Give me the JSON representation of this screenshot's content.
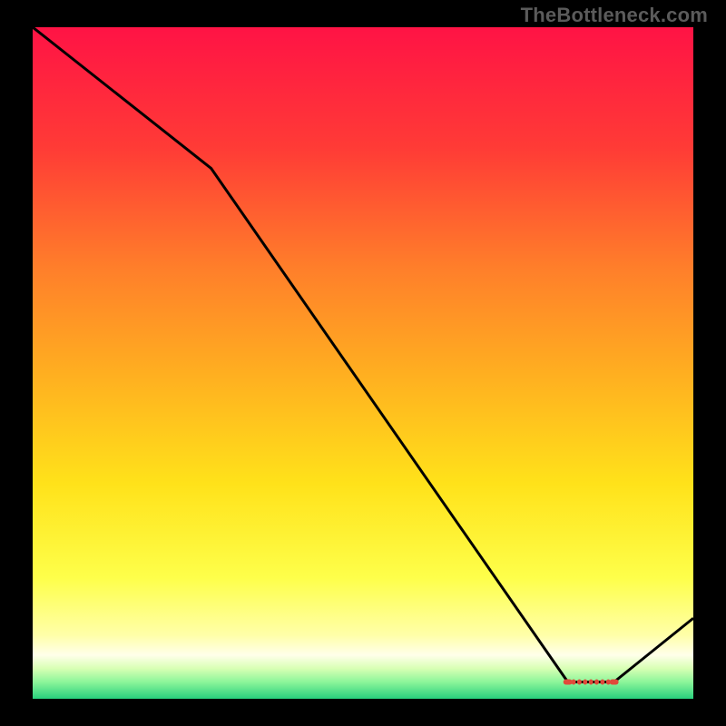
{
  "watermark": "TheBottleneck.com",
  "chart_data": {
    "type": "line",
    "title": "",
    "xlabel": "",
    "ylabel": "",
    "xlim": [
      0,
      100
    ],
    "ylim": [
      0,
      100
    ],
    "x": [
      0,
      27,
      81,
      88,
      100
    ],
    "values": [
      100,
      79,
      2.5,
      2.5,
      12
    ],
    "marker_region": {
      "x_start": 81,
      "x_end": 88,
      "y": 2.5
    },
    "gradient_stops": [
      {
        "offset": 0.0,
        "color": "#ff1345"
      },
      {
        "offset": 0.18,
        "color": "#ff3b36"
      },
      {
        "offset": 0.36,
        "color": "#ff7f2a"
      },
      {
        "offset": 0.52,
        "color": "#ffb020"
      },
      {
        "offset": 0.68,
        "color": "#ffe21a"
      },
      {
        "offset": 0.82,
        "color": "#feff4a"
      },
      {
        "offset": 0.905,
        "color": "#ffffa8"
      },
      {
        "offset": 0.935,
        "color": "#ffffea"
      },
      {
        "offset": 0.955,
        "color": "#d8ffb4"
      },
      {
        "offset": 0.975,
        "color": "#8cf59a"
      },
      {
        "offset": 1.0,
        "color": "#28d07d"
      }
    ]
  }
}
